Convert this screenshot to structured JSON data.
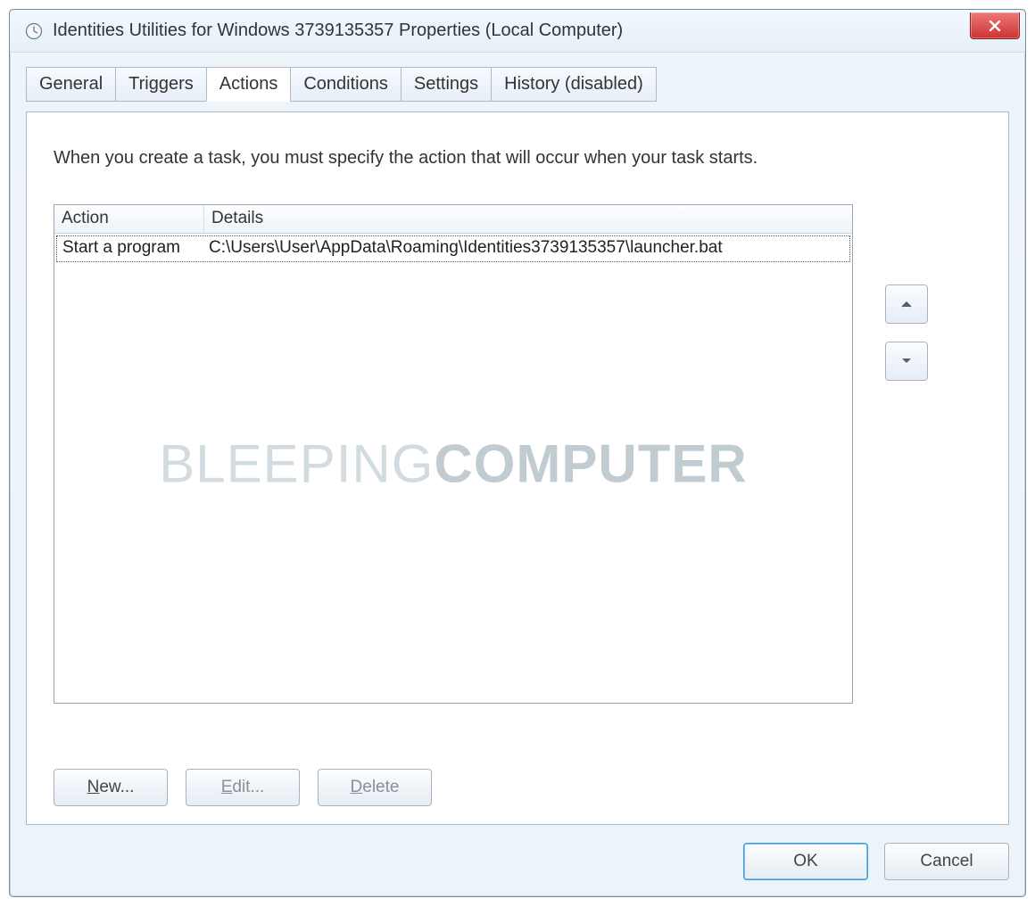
{
  "window": {
    "title": "Identities Utilities for Windows 3739135357 Properties (Local Computer)"
  },
  "tabs": {
    "general": "General",
    "triggers": "Triggers",
    "actions": "Actions",
    "conditions": "Conditions",
    "settings": "Settings",
    "history": "History (disabled)"
  },
  "panel": {
    "description": "When you create a task, you must specify the action that will occur when your task starts.",
    "columns": {
      "action": "Action",
      "details": "Details"
    },
    "rows": [
      {
        "action": "Start a program",
        "details": "C:\\Users\\User\\AppData\\Roaming\\Identities3739135357\\launcher.bat"
      }
    ],
    "buttons": {
      "new": "New...",
      "edit": "Edit...",
      "delete": "Delete"
    }
  },
  "dialog": {
    "ok": "OK",
    "cancel": "Cancel"
  },
  "watermark": {
    "part1": "BLEEPING",
    "part2": "COMPUTER"
  }
}
